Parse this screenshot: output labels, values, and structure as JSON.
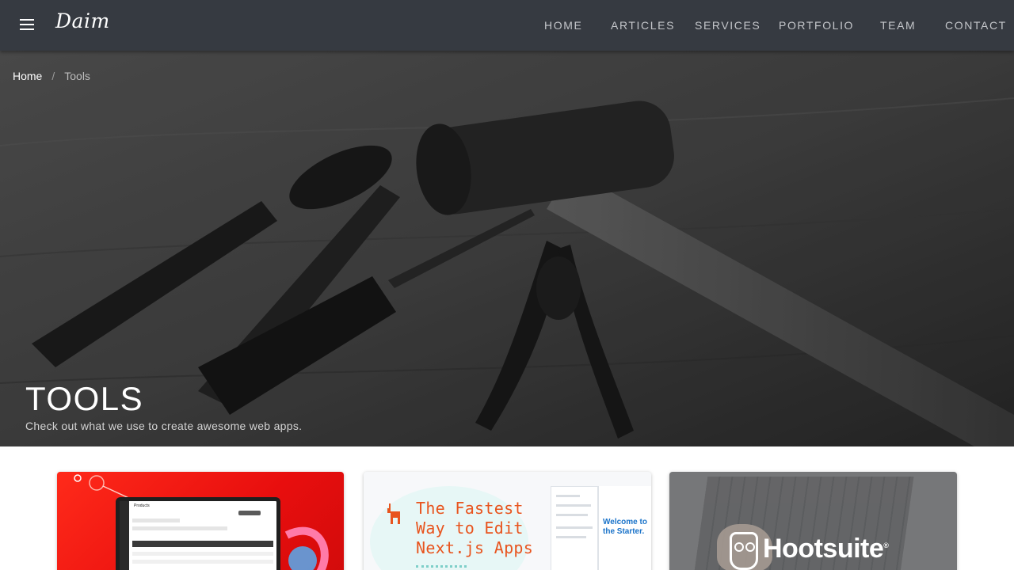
{
  "appbar": {
    "logo": "Daim",
    "nav": [
      "HOME",
      "ARTICLES",
      "SERVICES",
      "PORTFOLIO",
      "TEAM",
      "CONTACT"
    ]
  },
  "breadcrumb": {
    "home": "Home",
    "separator": "/",
    "current": "Tools"
  },
  "hero": {
    "title": "TOOLS",
    "subtitle": "Check out what we use to create awesome web apps."
  },
  "cards": [
    {
      "screen_title": "Products"
    },
    {
      "headline": "The Fastest Way to Edit Next.js Apps",
      "welcome": "Welcome to the Starter."
    },
    {
      "brand": "Hootsuite",
      "mark": "®"
    }
  ],
  "icons": {
    "menu": "menu-icon",
    "llama": "llama-icon",
    "owl": "owl-logo-icon"
  },
  "colors": {
    "appbar": "#363a41",
    "card1": "#ff1f14",
    "card2_text": "#e8541e",
    "card2_accent": "#1a73c9"
  }
}
